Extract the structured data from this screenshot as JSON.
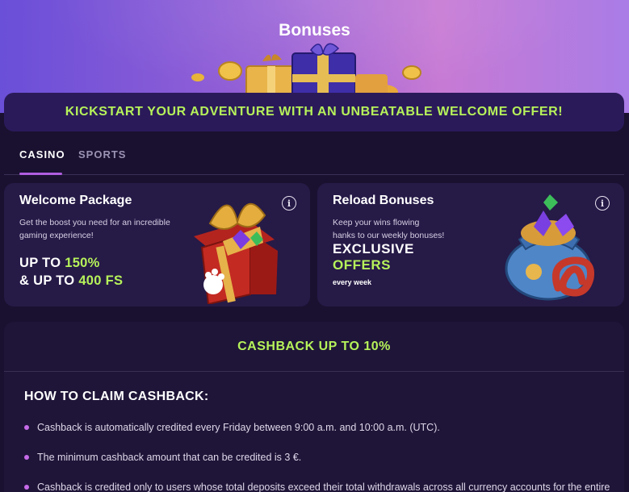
{
  "header": {
    "title": "Bonuses"
  },
  "banner": {
    "text": "KICKSTART YOUR ADVENTURE WITH AN UNBEATABLE WELCOME OFFER!"
  },
  "tabs": [
    {
      "label": "CASINO",
      "active": true
    },
    {
      "label": "SPORTS",
      "active": false
    }
  ],
  "cards": {
    "welcome": {
      "title": "Welcome Package",
      "description": "Get the boost you need for an incredible gaming experience!",
      "line1_prefix": "UP TO ",
      "line1_highlight": "150%",
      "line2_prefix": "& UP TO ",
      "line2_highlight": "400 FS",
      "info_icon": "info-icon"
    },
    "reload": {
      "title": "Reload Bonuses",
      "description_line1": "Keep your wins flowing",
      "description_line2": "hanks to our weekly bonuses!",
      "exclusive": "EXCLUSIVE",
      "offers": "OFFERS",
      "frequency": "every week",
      "info_icon": "info-icon"
    }
  },
  "cashback": {
    "heading": "CASHBACK UP TO 10%",
    "how_to_title": "HOW TO CLAIM CASHBACK:",
    "rules": [
      "Cashback is automatically credited every Friday between 9:00 a.m. and 10:00 a.m. (UTC).",
      "The minimum cashback amount that can be credited is 3 €.",
      "Cashback is credited only to users whose total deposits exceed their total withdrawals across all currency accounts for the entire"
    ]
  },
  "colors": {
    "accent_green": "#b6f25a",
    "accent_purple": "#b05de0",
    "background": "#1a1130",
    "card": "#261a47"
  }
}
